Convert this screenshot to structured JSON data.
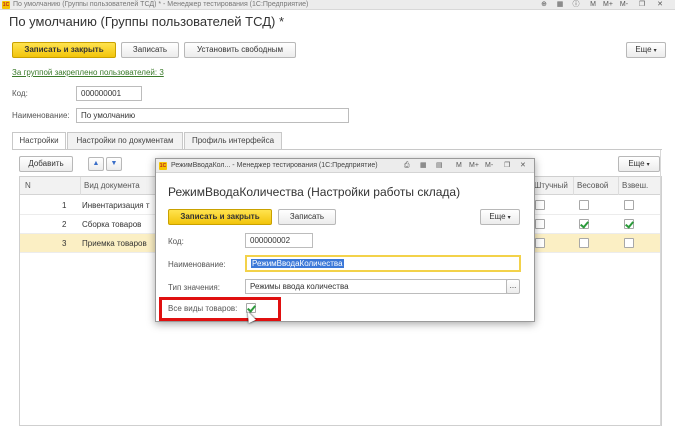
{
  "window": {
    "logo": "1С",
    "title": "По умолчанию (Группы пользователей ТСД) * - Менеджер тестирования (1С:Предприятие)",
    "icons": [
      "pin-icon",
      "grid-icon",
      "info-icon",
      "M",
      "M+",
      "M-",
      "restore-icon",
      "close-icon"
    ]
  },
  "form": {
    "title": "По умолчанию (Группы пользователей ТСД) *",
    "toolbar": {
      "save_close": "Записать и закрыть",
      "save": "Записать",
      "set_free": "Установить свободным",
      "more": "Еще"
    },
    "assigned_link": "За группой закреплено пользователей: 3",
    "code_label": "Код:",
    "code_value": "000000001",
    "name_label": "Наименование:",
    "name_value": "По умолчанию"
  },
  "tabs": [
    {
      "label": "Настройки",
      "active": true
    },
    {
      "label": "Настройки по документам",
      "active": false
    },
    {
      "label": "Профиль интерфейса",
      "active": false
    }
  ],
  "table_toolbar": {
    "add": "Добавить",
    "up_icon": "arrow-up-icon",
    "down_icon": "arrow-down-icon",
    "more": "Еще"
  },
  "table": {
    "columns": [
      "N",
      "Вид документа",
      "Штучный",
      "Весовой",
      "Взвеш."
    ],
    "rows": [
      {
        "n": "1",
        "doc": "Инвентаризация т",
        "piece": false,
        "weight": false,
        "weighed": false,
        "selected": false
      },
      {
        "n": "2",
        "doc": "Сборка товаров",
        "piece": false,
        "weight": true,
        "weighed": true,
        "selected": false
      },
      {
        "n": "3",
        "doc": "Приемка товаров",
        "piece": false,
        "weight": false,
        "weighed": false,
        "selected": true
      }
    ]
  },
  "dialog": {
    "window_title": "РежимВводаКол... - Менеджер тестирования (1С:Предприятие)",
    "title": "РежимВводаКоличества (Настройки работы склада)",
    "save_close": "Записать и закрыть",
    "save": "Записать",
    "more": "Еще",
    "code_label": "Код:",
    "code_value": "000000002",
    "name_label": "Наименование:",
    "name_value": "РежимВводаКоличества",
    "type_label": "Тип значения:",
    "type_value": "Режимы ввода количества",
    "type_button": "...",
    "all_goods_label": "Все виды товаров:",
    "all_goods_checked": true,
    "highlight_color": "#e01010"
  }
}
